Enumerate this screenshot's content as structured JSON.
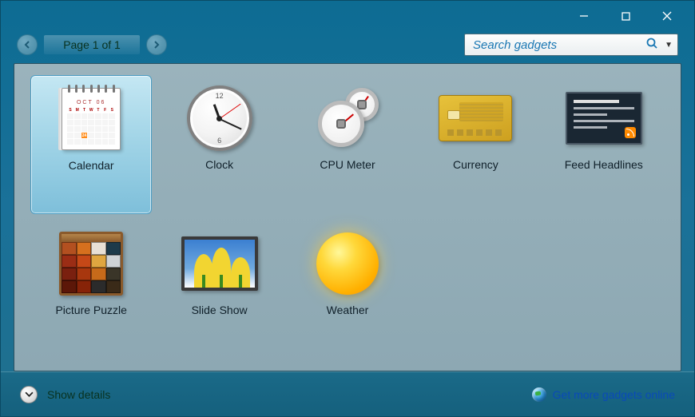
{
  "pagination": {
    "label": "Page 1 of 1"
  },
  "search": {
    "placeholder": "Search gadgets"
  },
  "gadgets": [
    {
      "label": "Calendar",
      "selected": true
    },
    {
      "label": "Clock",
      "selected": false
    },
    {
      "label": "CPU Meter",
      "selected": false
    },
    {
      "label": "Currency",
      "selected": false
    },
    {
      "label": "Feed Headlines",
      "selected": false
    },
    {
      "label": "Picture Puzzle",
      "selected": false
    },
    {
      "label": "Slide Show",
      "selected": false
    },
    {
      "label": "Weather",
      "selected": false
    }
  ],
  "footer": {
    "details_label": "Show details",
    "more_link": "Get more gadgets online"
  },
  "calendar_icon": {
    "month": "OCT 06",
    "highlighted_day": "24"
  }
}
